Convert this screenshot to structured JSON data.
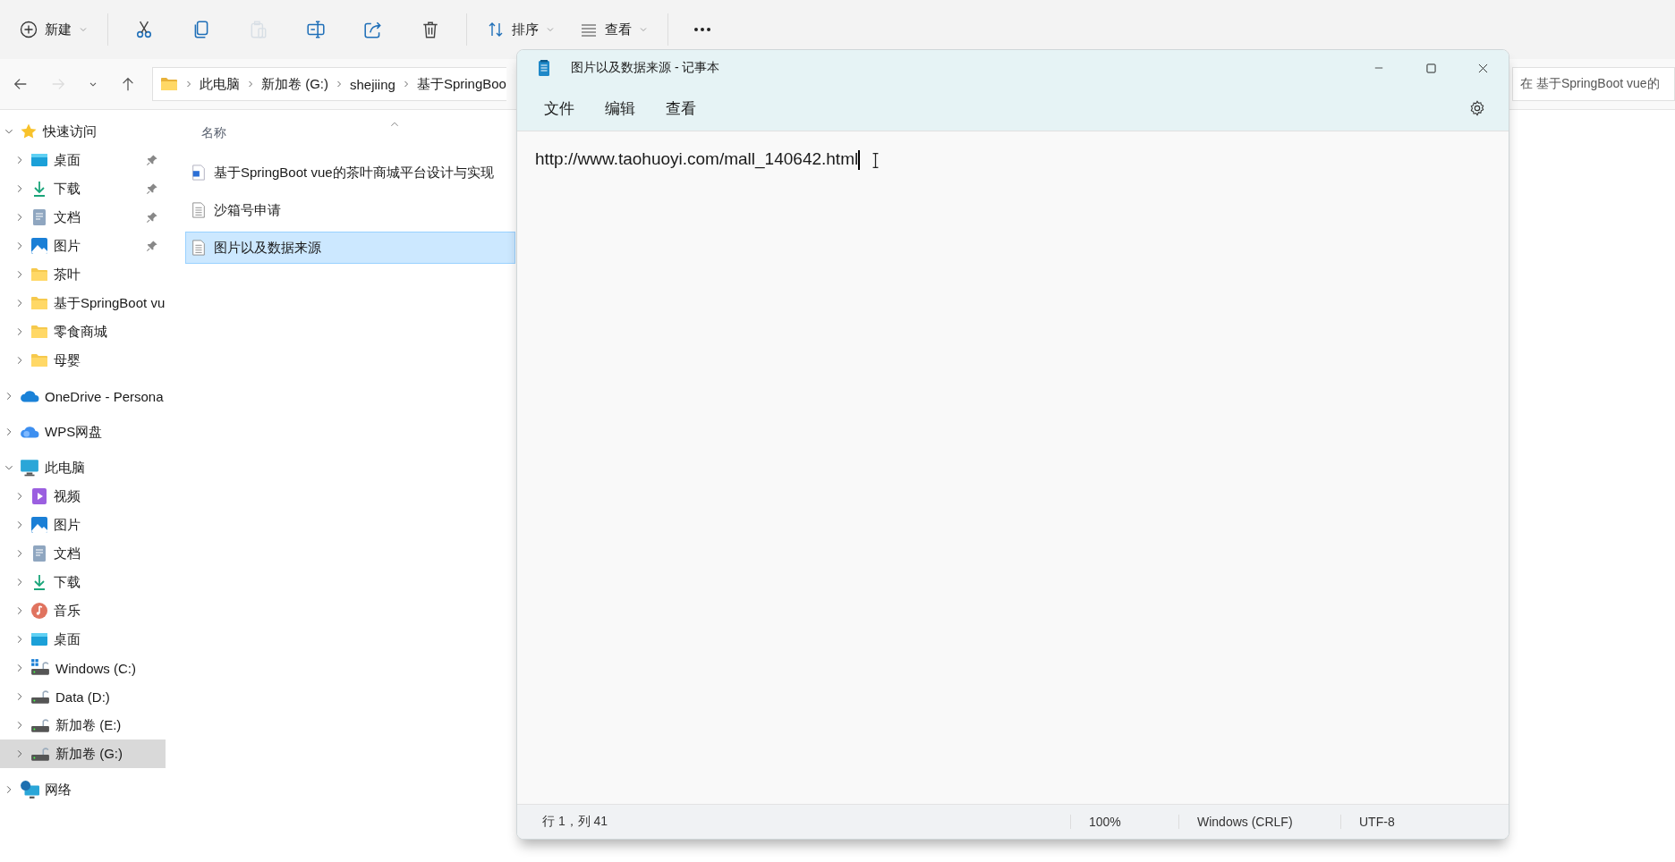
{
  "explorer": {
    "toolbar": [
      {
        "kind": "new",
        "label": "新建",
        "disabled": false
      },
      {
        "kind": "cut",
        "disabled": false
      },
      {
        "kind": "copy",
        "disabled": false
      },
      {
        "kind": "paste",
        "disabled": true
      },
      {
        "kind": "rename",
        "disabled": false
      },
      {
        "kind": "share",
        "disabled": false
      },
      {
        "kind": "delete",
        "disabled": false
      },
      {
        "kind": "sort",
        "label": "排序",
        "disabled": false
      },
      {
        "kind": "view",
        "label": "查看",
        "disabled": false
      },
      {
        "kind": "more",
        "disabled": false
      }
    ],
    "nav": [
      {
        "kind": "back",
        "disabled": false
      },
      {
        "kind": "forward",
        "disabled": true
      },
      {
        "kind": "recent",
        "disabled": false
      },
      {
        "kind": "up",
        "disabled": false
      }
    ],
    "address": {
      "segments": [
        "此电脑",
        "新加卷 (G:)",
        "shejiing",
        "基于SpringBoo"
      ]
    },
    "search": {
      "placeholder": "在 基于SpringBoot vue的"
    },
    "sidebar": {
      "items": [
        {
          "label": "快速访问",
          "kind": "star",
          "expanded": true,
          "selected": false,
          "children": [
            {
              "label": "桌面",
              "kind": "desktop",
              "pinned": true,
              "expanded": false,
              "selected": false
            },
            {
              "label": "下载",
              "kind": "download",
              "pinned": true,
              "expanded": false,
              "selected": false
            },
            {
              "label": "文档",
              "kind": "document",
              "pinned": true,
              "expanded": false,
              "selected": false
            },
            {
              "label": "图片",
              "kind": "pictures",
              "pinned": true,
              "expanded": false,
              "selected": false
            },
            {
              "label": "茶叶",
              "kind": "folder",
              "pinned": false,
              "expanded": false,
              "selected": false
            },
            {
              "label": "基于SpringBoot vu",
              "kind": "folder",
              "pinned": false,
              "expanded": false,
              "selected": false
            },
            {
              "label": "零食商城",
              "kind": "folder",
              "pinned": false,
              "expanded": false,
              "selected": false
            },
            {
              "label": "母婴",
              "kind": "folder",
              "pinned": false,
              "expanded": false,
              "selected": false
            }
          ]
        },
        {
          "label": "OneDrive - Persona",
          "kind": "cloud",
          "expanded": false,
          "selected": false
        },
        {
          "label": "WPS网盘",
          "kind": "cloud2",
          "expanded": false,
          "selected": false
        },
        {
          "label": "此电脑",
          "kind": "pc",
          "expanded": true,
          "selected": false,
          "children": [
            {
              "label": "视频",
              "kind": "video",
              "pinned": false,
              "expanded": false,
              "selected": false
            },
            {
              "label": "图片",
              "kind": "pictures",
              "pinned": false,
              "expanded": false,
              "selected": false
            },
            {
              "label": "文档",
              "kind": "document",
              "pinned": false,
              "expanded": false,
              "selected": false
            },
            {
              "label": "下载",
              "kind": "download",
              "pinned": false,
              "expanded": false,
              "selected": false
            },
            {
              "label": "音乐",
              "kind": "music",
              "pinned": false,
              "expanded": false,
              "selected": false
            },
            {
              "label": "桌面",
              "kind": "desktop",
              "pinned": false,
              "expanded": false,
              "selected": false
            },
            {
              "label": "Windows (C:)",
              "kind": "windrive",
              "pinned": false,
              "expanded": false,
              "selected": false
            },
            {
              "label": "Data (D:)",
              "kind": "drive",
              "pinned": false,
              "expanded": false,
              "selected": false
            },
            {
              "label": "新加卷 (E:)",
              "kind": "drive",
              "pinned": false,
              "expanded": false,
              "selected": false
            },
            {
              "label": "新加卷 (G:)",
              "kind": "drive",
              "pinned": false,
              "expanded": false,
              "selected": true
            }
          ]
        },
        {
          "label": "网络",
          "kind": "network",
          "expanded": false,
          "selected": false
        }
      ]
    },
    "columns": [
      {
        "label": "名称"
      }
    ],
    "files": [
      {
        "name": "基于SpringBoot vue的茶叶商城平台设计与实现",
        "kind": "word",
        "selected": false
      },
      {
        "name": "沙箱号申请",
        "kind": "text",
        "selected": false
      },
      {
        "name": "图片以及数据来源",
        "kind": "text",
        "selected": true
      }
    ]
  },
  "notepad": {
    "title": "图片以及数据来源 - 记事本",
    "menu": [
      "文件",
      "编辑",
      "查看"
    ],
    "content": "http://www.taohuoyi.com/mall_140642.html",
    "status": [
      "行 1，列 41",
      "100%",
      "Windows (CRLF)",
      "UTF-8"
    ]
  }
}
